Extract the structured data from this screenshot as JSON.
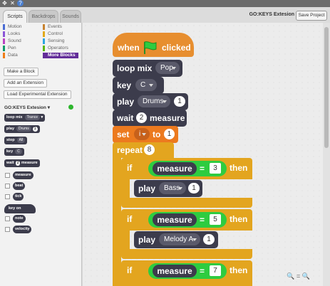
{
  "window": {
    "icons": [
      "move-icon",
      "close-icon",
      "help-icon"
    ],
    "icon_glyphs": [
      "✥",
      "✕",
      "?"
    ]
  },
  "tabs": [
    {
      "label": "Scripts",
      "active": true
    },
    {
      "label": "Backdrops"
    },
    {
      "label": "Sounds"
    }
  ],
  "project_title": "GO:KEYS Extesion",
  "save_label": "Save Project",
  "categories": [
    {
      "label": "Motion",
      "color": "#4a6cd4"
    },
    {
      "label": "Events",
      "color": "#c88330"
    },
    {
      "label": "Looks",
      "color": "#8a55d7"
    },
    {
      "label": "Control",
      "color": "#e1a91a"
    },
    {
      "label": "Sound",
      "color": "#bb42c3"
    },
    {
      "label": "Sensing",
      "color": "#2ca5e2"
    },
    {
      "label": "Pen",
      "color": "#0e9a6c"
    },
    {
      "label": "Operators",
      "color": "#5cb712"
    },
    {
      "label": "Data",
      "color": "#ee7d16"
    },
    {
      "label": "More Blocks",
      "color": "#632d99",
      "active": true
    }
  ],
  "palette_buttons": {
    "make_block": "Make a Block",
    "add_extension": "Add an Extension",
    "load_experimental": "Load Experimental Extension"
  },
  "extension": {
    "name": "GO:KEYS Extesion",
    "arrow": "▾",
    "status_color": "#2db62d"
  },
  "palette_blocks": {
    "loop_mix": {
      "label": "loop  mix",
      "value": "Trance"
    },
    "play": {
      "label": "play",
      "value": "Drums",
      "num": "1"
    },
    "stop": {
      "label": "stop",
      "value": "All"
    },
    "key": {
      "label": "key",
      "value": "C"
    },
    "wait": {
      "label": "wait",
      "num": "2",
      "unit": "measure"
    },
    "measure": "measure",
    "beat": "beat",
    "tick": "tick",
    "key_on": "key  on",
    "note": "note",
    "velocity": "velocity"
  },
  "script": {
    "when_clicked": {
      "when": "when",
      "clicked": "clicked"
    },
    "loop_mix": {
      "label": "loop  mix",
      "value": "Pop"
    },
    "key": {
      "label": "key",
      "value": "C"
    },
    "play": {
      "label": "play",
      "value": "Drums",
      "num": "1"
    },
    "wait": {
      "label": "wait",
      "num": "2",
      "unit": "measure"
    },
    "set": {
      "label": "set",
      "var": "i",
      "to": "to",
      "num": "1"
    },
    "repeat": {
      "label": "repeat",
      "num": "8"
    },
    "ifs": [
      {
        "if": "if",
        "var": "measure",
        "op": "=",
        "num": "3",
        "then": "then",
        "play": "play",
        "inst": "Bass",
        "inst_num": "1"
      },
      {
        "if": "if",
        "var": "measure",
        "op": "=",
        "num": "5",
        "then": "then",
        "play": "play",
        "inst": "Melody A",
        "inst_num": "1"
      },
      {
        "if": "if",
        "var": "measure",
        "op": "=",
        "num": "7",
        "then": "then"
      }
    ]
  },
  "zoom_controls": [
    "zoom-out-icon",
    "zoom-reset-icon",
    "zoom-in-icon"
  ],
  "zoom_glyphs": [
    "🔍",
    "=",
    "🔍"
  ]
}
